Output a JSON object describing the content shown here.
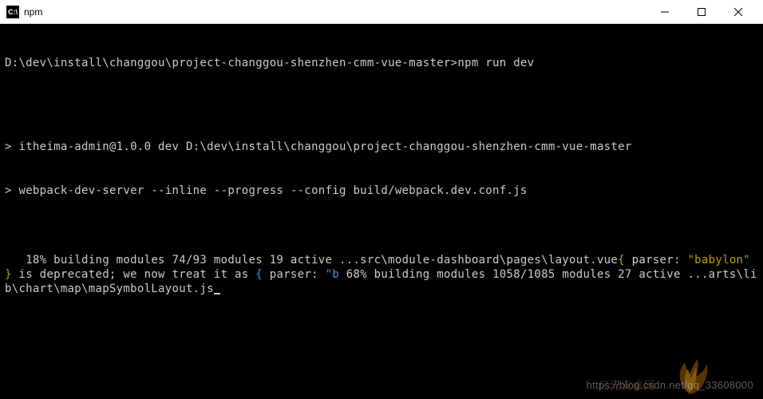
{
  "window": {
    "icon_text": "C:\\",
    "title": "npm"
  },
  "terminal": {
    "prompt_path": "D:\\dev\\install\\changgou\\project-changgou-shenzhen-cmm-vue-master>",
    "command": "npm run dev",
    "lines": {
      "l1_prefix": "> ",
      "l1": "itheima-admin@1.0.0 dev D:\\dev\\install\\changgou\\project-changgou-shenzhen-cmm-vue-master",
      "l2_prefix": "> ",
      "l2": "webpack-dev-server --inline --progress --config build/webpack.dev.conf.js",
      "l3a": " 18% building modules 74/93 modules 19 active ...src\\module-dashboard\\pages\\layout.vue",
      "l3b_brace_open": "{ ",
      "l3b_key": "parser: ",
      "l3b_val": "\"babylon\"",
      "l3b_brace_close": " }",
      "l3c": " is deprecated; we now treat it as ",
      "l3d_brace_open": "{ ",
      "l3d_key": "parser: ",
      "l3d_val": "\"b",
      "l3e": " 68% building modules 1058/1085 modules 27 active ...arts\\lib\\chart\\map\\mapSymbolLayout.js"
    }
  },
  "watermark": {
    "url": "https://blog.csdn.net/qq_33608000",
    "text2": "亿元安卓网"
  }
}
